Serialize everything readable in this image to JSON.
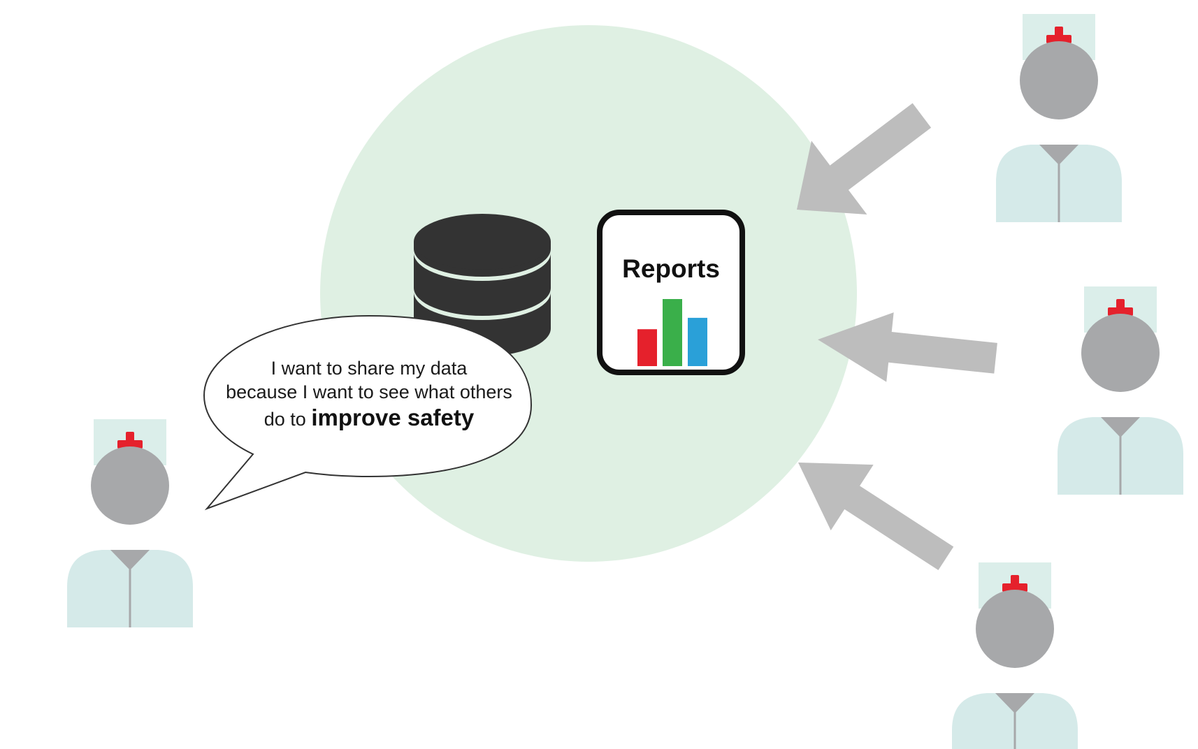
{
  "colors": {
    "circle": "#dff0e3",
    "database": "#333333",
    "database_bands": "#dff0e3",
    "arrow": "#bdbdbd",
    "person_head": "#a7a8aa",
    "person_body": "#d5eae9",
    "cap": "#dbeeea",
    "cross": "#e5212c",
    "bar_red": "#e5212c",
    "bar_green": "#3aaf4a",
    "bar_blue": "#2aa0d8"
  },
  "icons": {
    "database": "database-icon",
    "reports": "bar-chart-icon",
    "person": "nurse-icon",
    "arrow": "arrow-icon",
    "speech_bubble": "speech-bubble"
  },
  "speech": {
    "line1": "I want to share my data",
    "line2": "because I want to see what others",
    "line3_prefix": "do to ",
    "line3_emphasis": "improve safety"
  },
  "reports_card": {
    "title": "Reports",
    "bar_values": [
      0.55,
      1.0,
      0.72
    ]
  }
}
